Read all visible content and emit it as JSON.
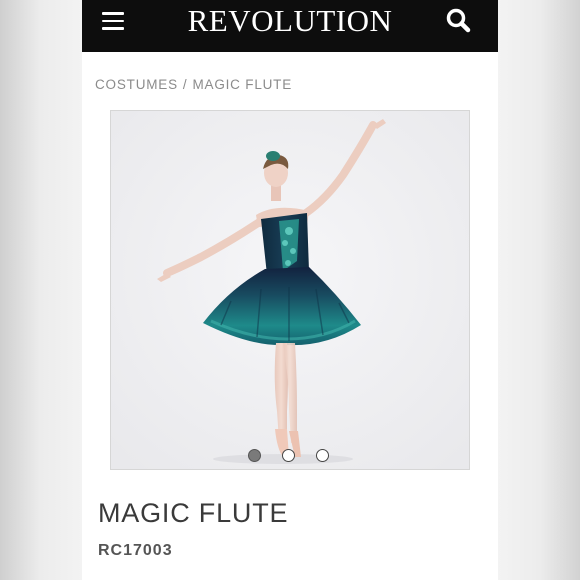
{
  "header": {
    "logo": "REVOLUTION",
    "menu_icon": "hamburger-menu-icon",
    "search_icon": "search-icon"
  },
  "breadcrumb": {
    "items": [
      "COSTUMES",
      "MAGIC FLUTE"
    ],
    "separator": "/"
  },
  "gallery": {
    "image": "ballerina-in-teal-tutu-photo",
    "dots_count": 3,
    "active_index": 0
  },
  "product": {
    "name": "MAGIC FLUTE",
    "sku": "RC17003"
  },
  "colors": {
    "header_bg": "#0d0d0d",
    "costume_teal": "#1e8a8a",
    "costume_navy": "#12223f"
  }
}
